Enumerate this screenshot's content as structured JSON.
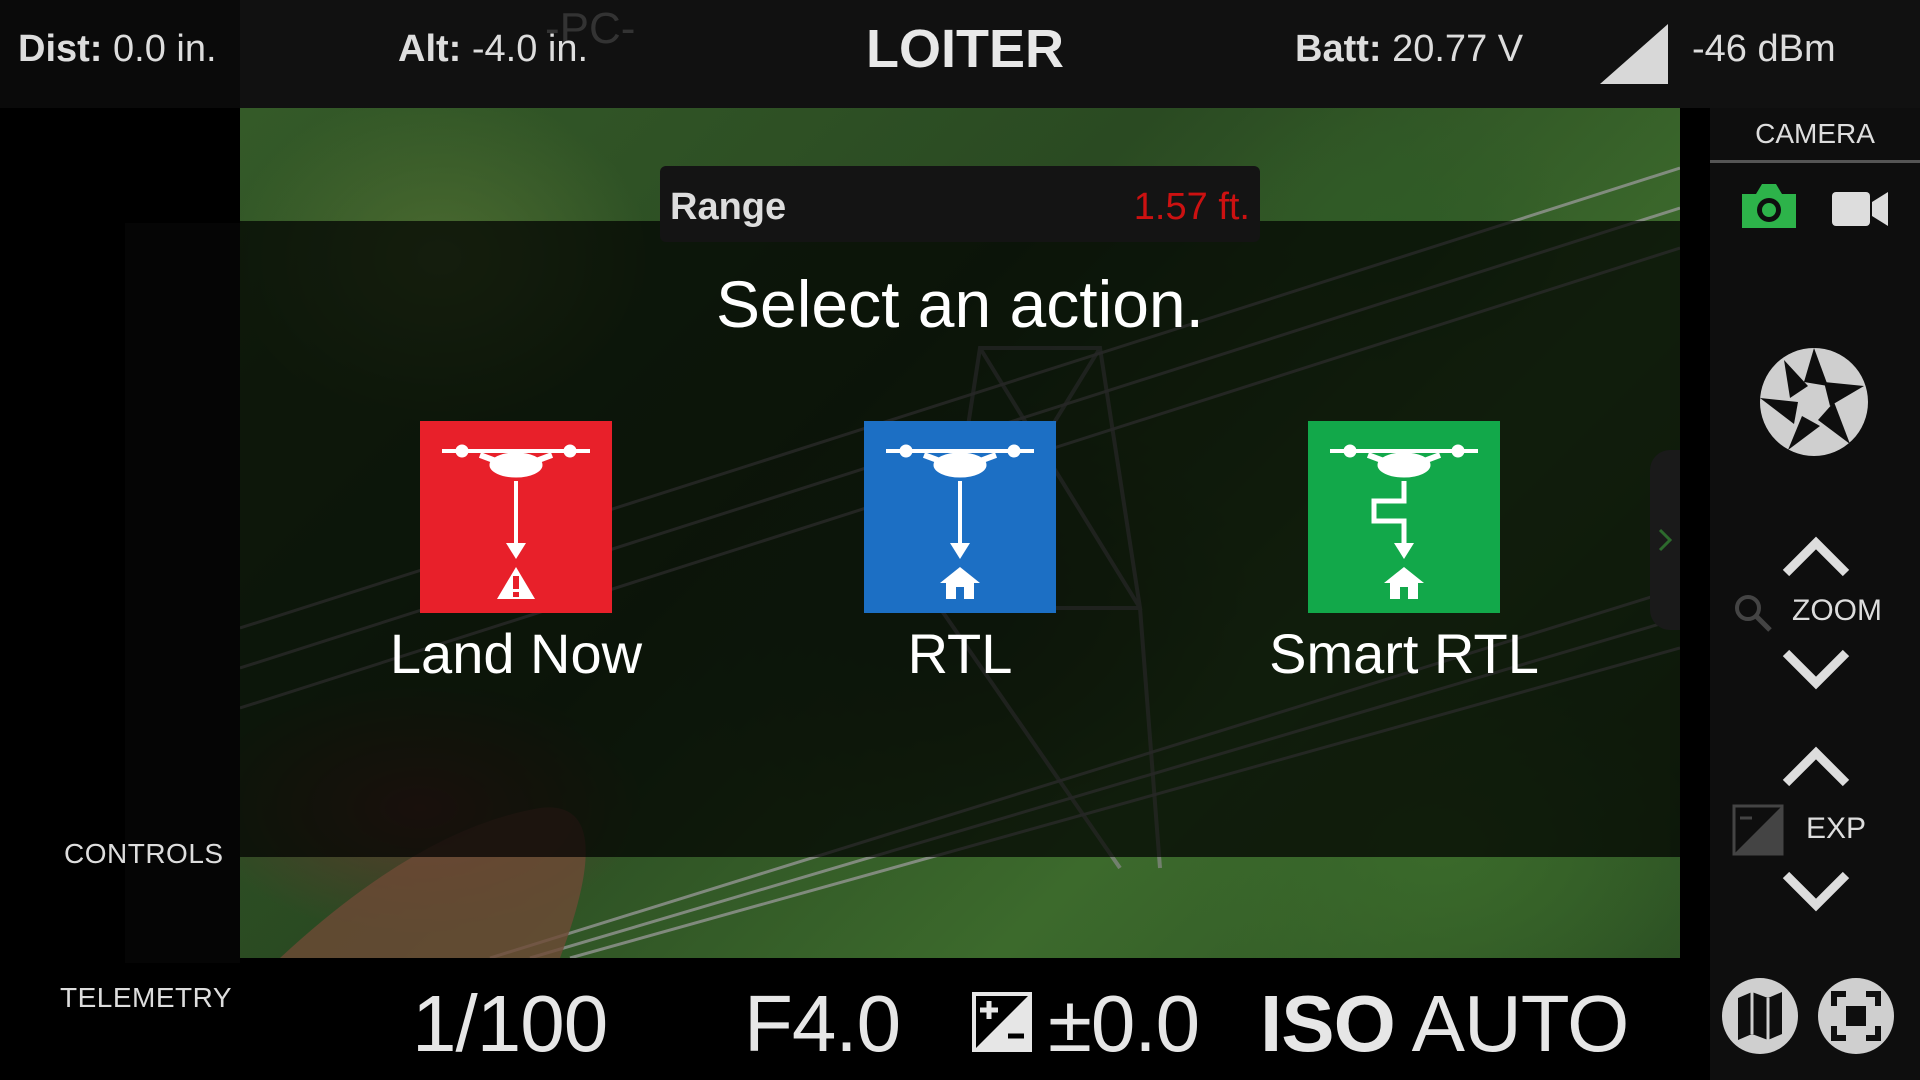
{
  "top_bar": {
    "dist_label": "Dist:",
    "dist_value": "0.0 in.",
    "alt_label": "Alt:",
    "alt_value": "-4.0 in.",
    "flight_mode": "LOITER",
    "ghost_text": "-PC-",
    "batt_label": "Batt:",
    "batt_value": "20.77 V",
    "signal_icon": "signal-strength-icon",
    "signal_value": "-46 dBm"
  },
  "range": {
    "label": "Range",
    "value": "1.57 ft."
  },
  "dialog": {
    "prompt": "Select an action.",
    "actions": [
      {
        "label": "Land Now",
        "color": "#e8202a",
        "icon": "land-now-icon"
      },
      {
        "label": "RTL",
        "color": "#1c6fc4",
        "icon": "rtl-icon"
      },
      {
        "label": "Smart RTL",
        "color": "#12a84a",
        "icon": "smart-rtl-icon"
      }
    ]
  },
  "left_panel": {
    "controls_label": "CONTROLS",
    "telemetry_label": "TELEMETRY"
  },
  "right_panel": {
    "camera_tab": "CAMERA",
    "zoom_label": "ZOOM",
    "exp_label": "EXP",
    "photo_mode_color": "#2db34a"
  },
  "camera_settings": {
    "shutter": "1/100",
    "aperture": "F4.0",
    "exposure_comp": "±0.0",
    "iso_label": "ISO",
    "iso_value": "AUTO"
  }
}
